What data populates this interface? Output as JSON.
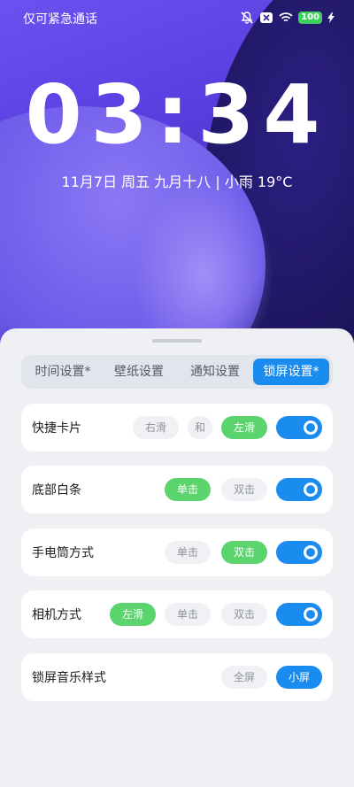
{
  "status_bar": {
    "text": "仅可紧急通话",
    "battery": "100"
  },
  "lockscreen": {
    "time": "03:34",
    "date_line": "11月7日 周五 九月十八 | 小雨 19°C"
  },
  "tabs": [
    {
      "label": "时间设置*",
      "active": false
    },
    {
      "label": "壁纸设置",
      "active": false
    },
    {
      "label": "通知设置",
      "active": false
    },
    {
      "label": "锁屏设置*",
      "active": true
    }
  ],
  "settings": {
    "shortcut_card": {
      "label": "快捷卡片",
      "opt1": "右滑",
      "joiner": "和",
      "opt2": "左滑",
      "selected": "左滑",
      "enabled": true
    },
    "bottom_bar": {
      "label": "底部白条",
      "opt1": "单击",
      "opt2": "双击",
      "selected": "单击",
      "enabled": true
    },
    "flashlight": {
      "label": "手电筒方式",
      "opt1": "单击",
      "opt2": "双击",
      "selected": "双击",
      "enabled": true
    },
    "camera": {
      "label": "相机方式",
      "opt1": "左滑",
      "opt2": "单击",
      "opt3": "双击",
      "selected": "左滑",
      "enabled": true
    },
    "music_style": {
      "label": "锁屏音乐样式",
      "opt1": "全屏",
      "opt2": "小屏",
      "selected": "小屏"
    }
  },
  "colors": {
    "accent_blue": "#1a8cf0",
    "selected_green": "#5cd46e"
  }
}
